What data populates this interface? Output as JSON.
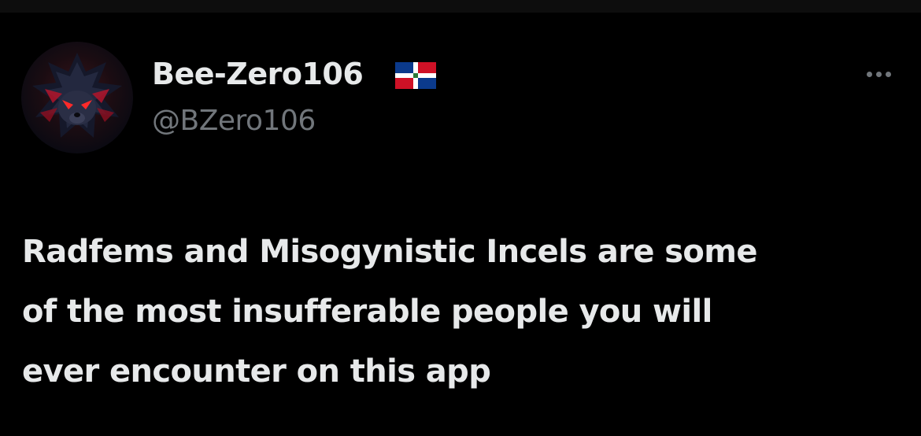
{
  "author": {
    "display_name": "Bee-Zero106",
    "handle": "@BZero106",
    "flag_icon": "dominican-republic-flag-icon",
    "avatar_icon": "hedgehog-avatar"
  },
  "tweet": {
    "lines": [
      "Radfems and Misogynistic Incels are some",
      "of the most insufferable people you will",
      "ever encounter on this app"
    ]
  },
  "colors": {
    "background": "#000000",
    "primary_text": "#e7e9ea",
    "secondary_text": "#71767b"
  },
  "more_icon": "more-horizontal-icon"
}
